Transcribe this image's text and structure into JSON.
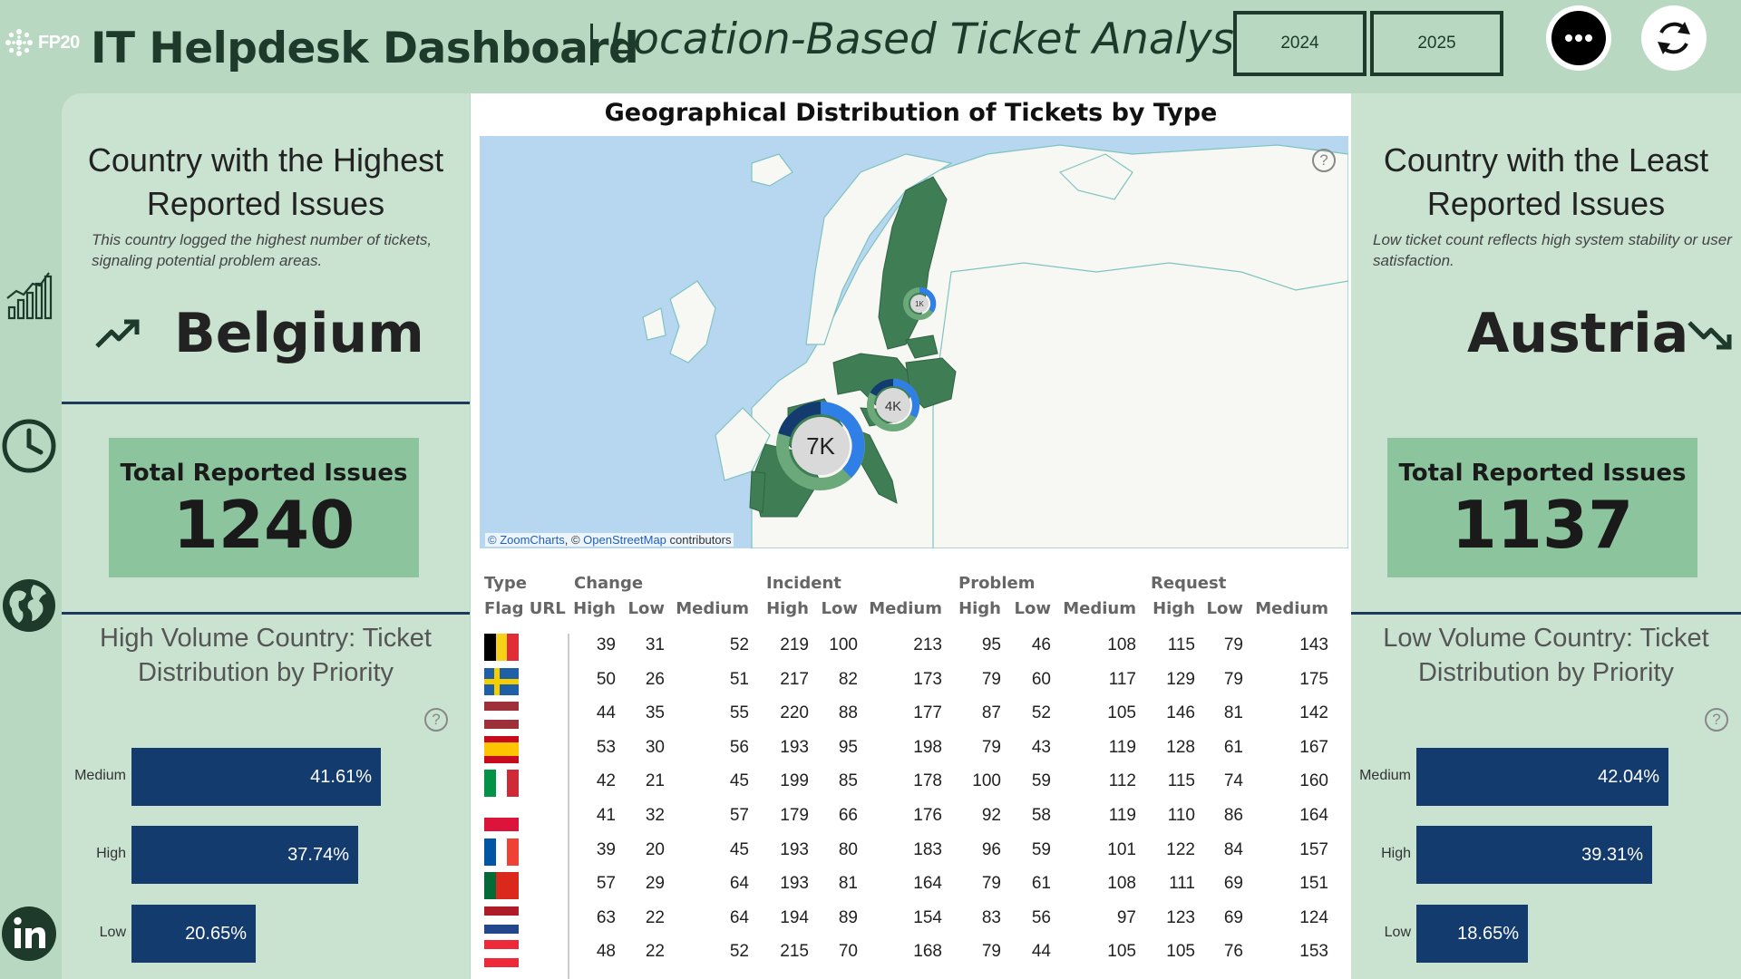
{
  "header": {
    "logo_text": "FP20",
    "title": "IT Helpdesk Dashboard",
    "subtitle": "Location-Based Ticket Analysis",
    "years": [
      "2024",
      "2025"
    ],
    "more_icon": "more-dots-icon",
    "refresh_icon": "refresh-icon"
  },
  "rail_icons": [
    "growth-chart-icon",
    "clock-icon",
    "globe-icon",
    "linkedin-icon"
  ],
  "left_panel": {
    "heading_line1": "Country with the Highest",
    "heading_line2": "Reported Issues",
    "desc_line1": "This country logged the highest number of tickets,",
    "desc_line2": "signaling potential problem areas.",
    "trend_icon": "trend-up-icon",
    "country": "Belgium",
    "total_label": "Total Reported Issues",
    "total_value": "1240",
    "dist_title_line1": "High Volume Country: Ticket",
    "dist_title_line2": "Distribution by Priority",
    "bars": [
      {
        "label": "Medium",
        "value": 41.61,
        "text": "41.61%"
      },
      {
        "label": "High",
        "value": 37.74,
        "text": "37.74%"
      },
      {
        "label": "Low",
        "value": 20.65,
        "text": "20.65%"
      }
    ]
  },
  "right_panel": {
    "heading_line1": "Country with the Least",
    "heading_line2": "Reported Issues",
    "desc_line1": "Low ticket count reflects high system stability or user",
    "desc_line2": "satisfaction.",
    "trend_icon": "trend-down-icon",
    "country": "Austria",
    "total_label": "Total Reported Issues",
    "total_value": "1137",
    "dist_title_line1": "Low Volume Country: Ticket",
    "dist_title_line2": "Distribution by Priority",
    "bars": [
      {
        "label": "Medium",
        "value": 42.04,
        "text": "42.04%"
      },
      {
        "label": "High",
        "value": 39.31,
        "text": "39.31%"
      },
      {
        "label": "Low",
        "value": 18.65,
        "text": "18.65%"
      }
    ]
  },
  "map": {
    "title": "Geographical Distribution of Tickets by Type",
    "credit_a": "© ZoomCharts",
    "credit_b": ", © ",
    "credit_c": "OpenStreetMap",
    "credit_d": " contributors",
    "bubbles": [
      {
        "label": "7K",
        "value": 7000
      },
      {
        "label": "4K",
        "value": 4000
      },
      {
        "label": "1K",
        "value": 1000
      }
    ],
    "colors": {
      "sea": "#b7d7f1",
      "land": "#f7f7f4",
      "country": "#3f7d55",
      "ring_blue": "#2f7fe6",
      "ring_dark": "#133b6e",
      "ring_green": "#6ba97a"
    }
  },
  "table": {
    "header_row1": [
      "Type",
      "Change",
      "Incident",
      "Problem",
      "Request"
    ],
    "header_row2": [
      "Flag URL",
      "High",
      "Low",
      "Medium",
      "High",
      "Low",
      "Medium",
      "High",
      "Low",
      "Medium",
      "High",
      "Low",
      "Medium"
    ],
    "rows": [
      {
        "flag": "belgium",
        "values": [
          "39",
          "31",
          "52",
          "219",
          "100",
          "213",
          "95",
          "46",
          "108",
          "115",
          "79",
          "143"
        ]
      },
      {
        "flag": "sweden",
        "values": [
          "50",
          "26",
          "51",
          "217",
          "82",
          "173",
          "79",
          "60",
          "117",
          "129",
          "79",
          "175"
        ]
      },
      {
        "flag": "latvia",
        "values": [
          "44",
          "35",
          "55",
          "220",
          "88",
          "177",
          "87",
          "52",
          "105",
          "146",
          "81",
          "142"
        ]
      },
      {
        "flag": "spain",
        "values": [
          "53",
          "30",
          "56",
          "193",
          "95",
          "198",
          "79",
          "43",
          "119",
          "128",
          "61",
          "167"
        ]
      },
      {
        "flag": "italy",
        "values": [
          "42",
          "21",
          "45",
          "199",
          "85",
          "178",
          "100",
          "59",
          "112",
          "115",
          "74",
          "160"
        ]
      },
      {
        "flag": "poland",
        "values": [
          "41",
          "32",
          "57",
          "179",
          "66",
          "176",
          "92",
          "58",
          "119",
          "110",
          "86",
          "164"
        ]
      },
      {
        "flag": "france",
        "values": [
          "39",
          "20",
          "45",
          "193",
          "80",
          "183",
          "96",
          "59",
          "101",
          "122",
          "84",
          "157"
        ]
      },
      {
        "flag": "portugal",
        "values": [
          "57",
          "29",
          "64",
          "193",
          "81",
          "164",
          "79",
          "61",
          "108",
          "111",
          "69",
          "151"
        ]
      },
      {
        "flag": "netherlands",
        "values": [
          "63",
          "22",
          "64",
          "194",
          "89",
          "154",
          "83",
          "56",
          "97",
          "123",
          "69",
          "124"
        ]
      },
      {
        "flag": "austria",
        "values": [
          "48",
          "22",
          "52",
          "215",
          "70",
          "168",
          "79",
          "44",
          "105",
          "105",
          "76",
          "153"
        ]
      }
    ]
  }
}
